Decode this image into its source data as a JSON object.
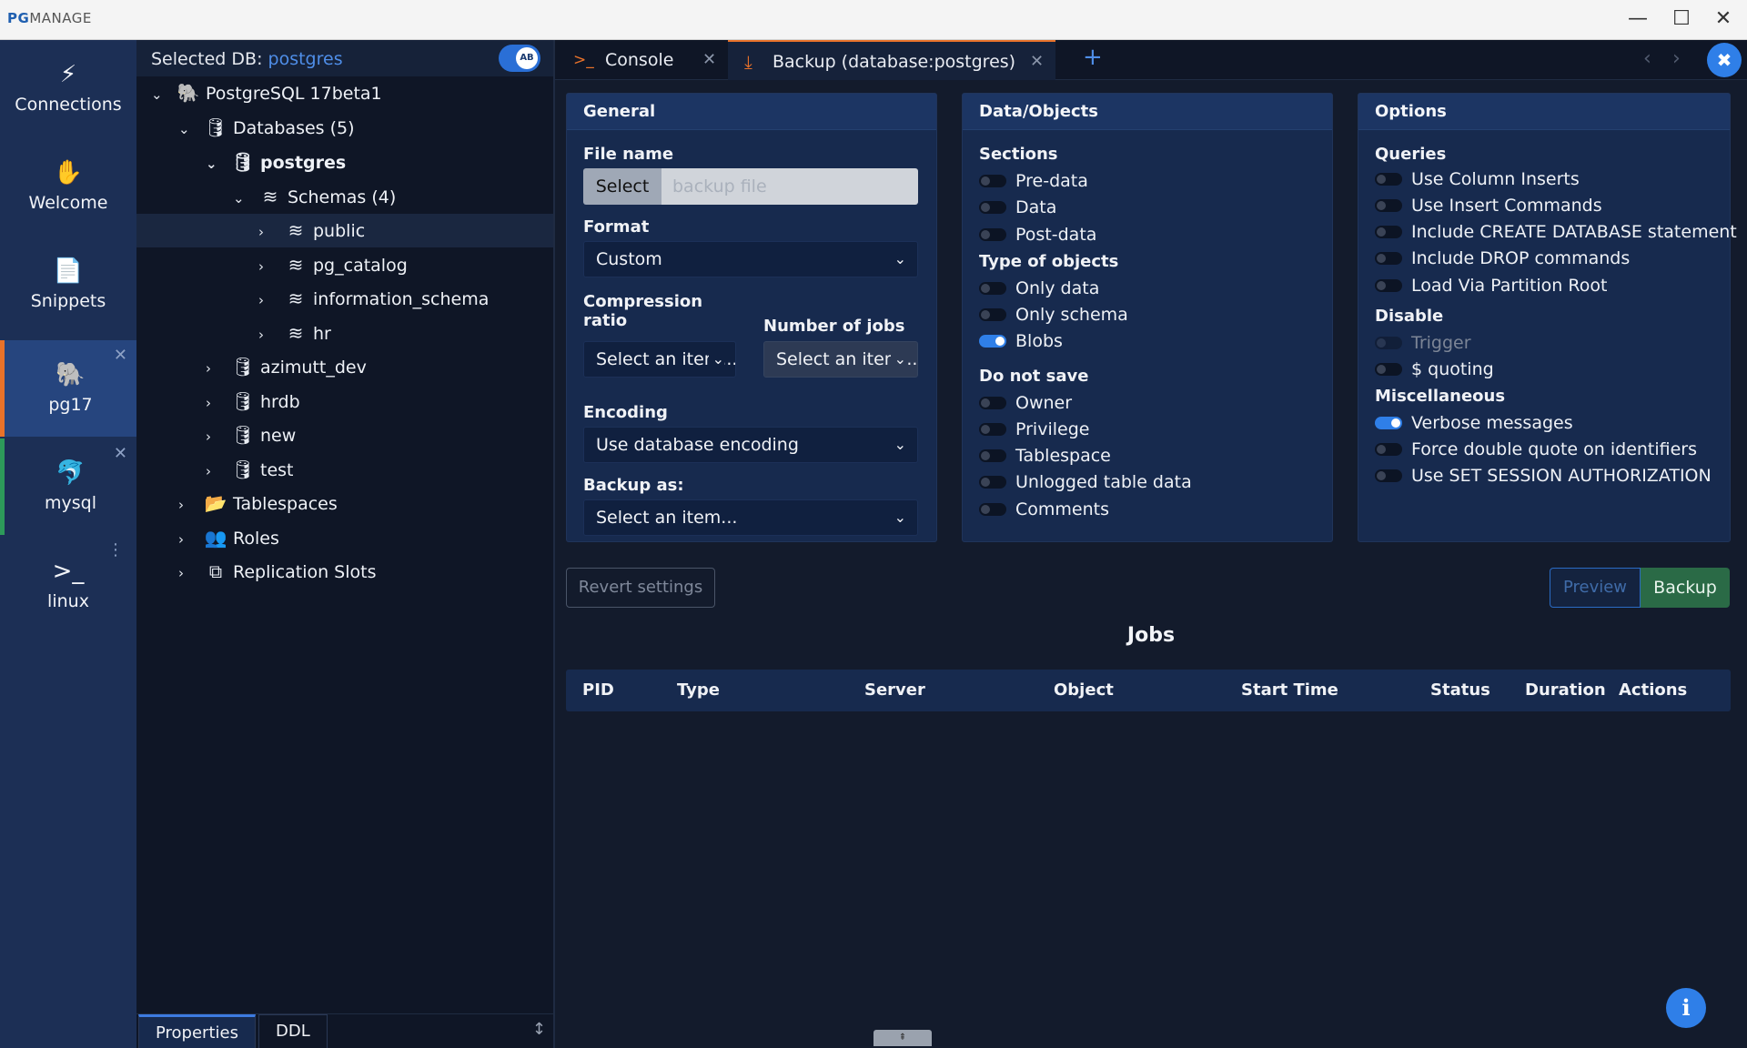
{
  "window": {
    "app_name_bold": "PG",
    "app_name_rest": "MANAGE",
    "minimize": "—",
    "maximize": "☐",
    "close": "✕"
  },
  "nav": {
    "items": [
      {
        "label": "Connections",
        "icon": "⚡"
      },
      {
        "label": "Welcome",
        "icon": "✋"
      },
      {
        "label": "Snippets",
        "icon": "📄"
      },
      {
        "label": "pg17",
        "icon": "🐘"
      },
      {
        "label": "mysql",
        "icon": "🐬"
      },
      {
        "label": "linux",
        "icon": ">_"
      }
    ],
    "close_glyph": "✕",
    "dots_glyph": "⋮"
  },
  "tree": {
    "selected_db_label": "Selected DB: ",
    "selected_db": "postgres",
    "toggle_text": "AB",
    "rows": [
      {
        "label": "PostgreSQL 17beta1",
        "chev": "⌄"
      },
      {
        "label": "Databases (5)",
        "chev": "⌄"
      },
      {
        "label": "postgres",
        "chev": "⌄"
      },
      {
        "label": "Schemas (4)",
        "chev": "⌄"
      },
      {
        "label": "public",
        "chev": "›"
      },
      {
        "label": "pg_catalog",
        "chev": "›"
      },
      {
        "label": "information_schema",
        "chev": "›"
      },
      {
        "label": "hr",
        "chev": "›"
      },
      {
        "label": "azimutt_dev",
        "chev": "›"
      },
      {
        "label": "hrdb",
        "chev": "›"
      },
      {
        "label": "new",
        "chev": "›"
      },
      {
        "label": "test",
        "chev": "›"
      },
      {
        "label": "Tablespaces",
        "chev": "›"
      },
      {
        "label": "Roles",
        "chev": "›"
      },
      {
        "label": "Replication Slots",
        "chev": "›"
      }
    ],
    "bottom_tabs": [
      "Properties",
      "DDL"
    ],
    "resize_glyph": "↕"
  },
  "tabs": [
    {
      "label": "Console",
      "icon": ">_"
    },
    {
      "label": "Backup (database:postgres)",
      "icon": "⤓"
    }
  ],
  "tab_close": "✕",
  "add_tab": "+",
  "arrows": {
    "left": "‹",
    "right": "›"
  },
  "tools_icon": "✖",
  "general": {
    "title": "General",
    "file_name_label": "File name",
    "select_button": "Select",
    "file_placeholder": "backup file",
    "format_label": "Format",
    "format_value": "Custom",
    "compression_label_1": "Compression",
    "compression_label_2": "ratio",
    "compression_value": "Select an item...",
    "jobs_label": "Number of jobs",
    "jobs_value": "Select an item...",
    "encoding_label": "Encoding",
    "encoding_value": "Use database encoding",
    "backup_as_label": "Backup as:",
    "backup_as_value": "Select an item..."
  },
  "data_objects": {
    "title": "Data/Objects",
    "sections_label": "Sections",
    "sections": [
      {
        "label": "Pre-data",
        "on": false
      },
      {
        "label": "Data",
        "on": false
      },
      {
        "label": "Post-data",
        "on": false
      }
    ],
    "type_label": "Type of objects",
    "types": [
      {
        "label": "Only data",
        "on": false
      },
      {
        "label": "Only schema",
        "on": false
      },
      {
        "label": "Blobs",
        "on": true
      }
    ],
    "nosave_label": "Do not save",
    "nosave": [
      {
        "label": "Owner",
        "on": false
      },
      {
        "label": "Privilege",
        "on": false
      },
      {
        "label": "Tablespace",
        "on": false
      },
      {
        "label": "Unlogged table data",
        "on": false
      },
      {
        "label": "Comments",
        "on": false
      }
    ]
  },
  "options": {
    "title": "Options",
    "queries_label": "Queries",
    "queries": [
      {
        "label": "Use Column Inserts",
        "on": false
      },
      {
        "label": "Use Insert Commands",
        "on": false
      },
      {
        "label": "Include CREATE DATABASE statement",
        "on": false
      },
      {
        "label": "Include DROP commands",
        "on": false
      },
      {
        "label": "Load Via Partition Root",
        "on": false
      }
    ],
    "disable_label": "Disable",
    "disable": [
      {
        "label": "Trigger",
        "on": false,
        "disabled": true
      },
      {
        "label": "$ quoting",
        "on": false,
        "disabled": false
      }
    ],
    "misc_label": "Miscellaneous",
    "misc": [
      {
        "label": "Verbose messages",
        "on": true
      },
      {
        "label": "Force double quote on identifiers",
        "on": false
      },
      {
        "label": "Use SET SESSION AUTHORIZATION",
        "on": false
      }
    ]
  },
  "actions": {
    "revert": "Revert settings",
    "preview": "Preview",
    "backup": "Backup"
  },
  "jobs": {
    "title": "Jobs",
    "columns": [
      "PID",
      "Type",
      "Server",
      "Object",
      "Start Time",
      "Status",
      "Duration",
      "Actions"
    ]
  },
  "info_icon": "i",
  "drag_glyph": "⇞",
  "colors": {
    "accent": "#2f7fe8",
    "active_tab_border": "#e8722a",
    "backup_button": "#2a6a46",
    "selected_db": "#4f8ee8"
  }
}
